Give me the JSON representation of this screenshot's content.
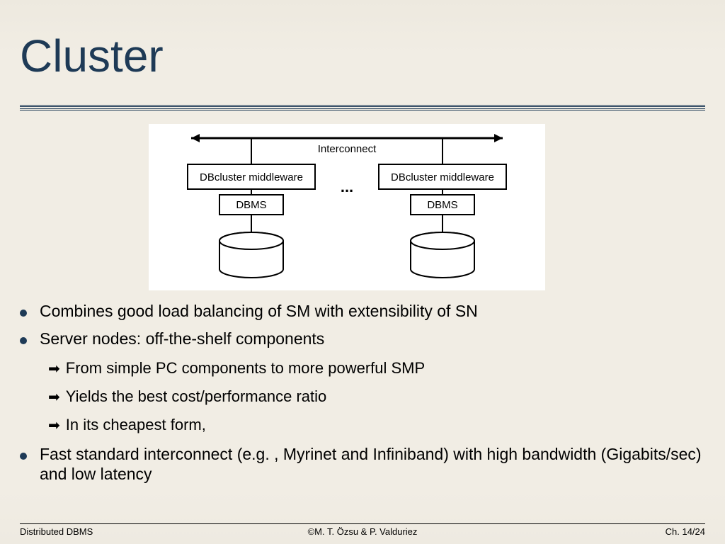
{
  "title": "Cluster",
  "diagram": {
    "interconnect": "Interconnect",
    "middleware": "DBcluster middleware",
    "dbms": "DBMS",
    "ellipsis": "..."
  },
  "bullets": {
    "b1": "Combines good load balancing of SM with extensibility of SN",
    "b2": "Server nodes: off-the-shelf components",
    "sub1": "From simple PC components to more powerful SMP",
    "sub2": "Yields the best cost/performance ratio",
    "sub3": "In its cheapest form,",
    "b3": "Fast standard interconnect (e.g. , Myrinet and Infiniband) with high bandwidth (Gigabits/sec) and low latency"
  },
  "footer": {
    "left": "Distributed DBMS",
    "center": "©M. T. Özsu & P. Valduriez",
    "right": "Ch. 14/24"
  }
}
